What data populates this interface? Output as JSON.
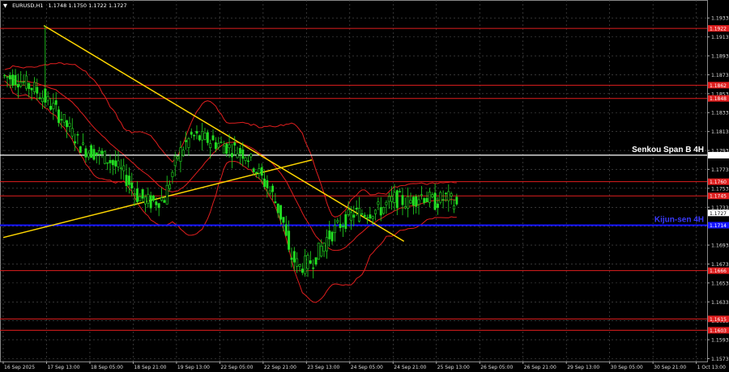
{
  "header": {
    "symbol": "EURUSD,H1",
    "ohlc": "1.1748 1.1750 1.1722 1.1727"
  },
  "chart_data": {
    "type": "candlestick",
    "symbol": "EURUSD,H1",
    "price_axis": {
      "min": 1.157,
      "max": 1.1952,
      "tick_labels": [
        "1.1933",
        "1.1913",
        "1.1893",
        "1.1873",
        "1.1853",
        "1.1833",
        "1.1813",
        "1.1793",
        "1.1773",
        "1.1753",
        "1.1733",
        "1.1713",
        "1.1693",
        "1.1673",
        "1.1653",
        "1.1633",
        "1.1613",
        "1.1593",
        "1.1573"
      ],
      "tick_values": [
        1.1933,
        1.1913,
        1.1893,
        1.1873,
        1.1853,
        1.1833,
        1.1813,
        1.1793,
        1.1773,
        1.1753,
        1.1733,
        1.1713,
        1.1693,
        1.1673,
        1.1653,
        1.1633,
        1.1613,
        1.1593,
        1.1573
      ]
    },
    "time_axis": {
      "labels": [
        "16 Sep 2025",
        "17 Sep 13:00",
        "18 Sep 05:00",
        "18 Sep 21:00",
        "19 Sep 13:00",
        "22 Sep 05:00",
        "22 Sep 21:00",
        "23 Sep 13:00",
        "24 Sep 05:00",
        "24 Sep 21:00",
        "25 Sep 13:00",
        "26 Sep 05:00",
        "26 Sep 21:00",
        "29 Sep 13:00",
        "30 Sep 05:00",
        "30 Sep 21:00",
        "1 Oct 13:00"
      ],
      "bars_per_label": 16,
      "total_bars": 260
    },
    "levels": [
      {
        "label": "1.1922",
        "value": 1.1922,
        "color": "#e01e1e"
      },
      {
        "label": "1.1862",
        "value": 1.1862,
        "color": "#e01e1e"
      },
      {
        "label": "1.1848",
        "value": 1.1848,
        "color": "#e01e1e"
      },
      {
        "label": "1.1788",
        "value": 1.1788,
        "color": "#ffffff",
        "name": "Senkou Span B 4H"
      },
      {
        "label": "1.1760",
        "value": 1.176,
        "color": "#e01e1e"
      },
      {
        "label": "1.1745",
        "value": 1.1745,
        "color": "#e01e1e"
      },
      {
        "label": "1.1727",
        "value": 1.1727,
        "color": "#ffffff",
        "current": true
      },
      {
        "label": "1.1714",
        "value": 1.1714,
        "color": "#1414ff",
        "name": "Kijun-sen 4H"
      },
      {
        "label": "1.1666",
        "value": 1.1666,
        "color": "#e01e1e"
      },
      {
        "label": "1.1615",
        "value": 1.1615,
        "color": "#e01e1e"
      },
      {
        "label": "1.1603",
        "value": 1.1603,
        "color": "#e01e1e"
      }
    ],
    "trendlines": [
      {
        "color": "#ffd700",
        "from": {
          "bar": 15,
          "price": 1.1925
        },
        "to": {
          "bar": 148,
          "price": 1.1697
        }
      },
      {
        "color": "#ffd700",
        "from": {
          "bar": 0,
          "price": 1.1701
        },
        "to": {
          "bar": 114,
          "price": 1.1783
        }
      }
    ],
    "price_path": [
      [
        0,
        1.1872
      ],
      [
        6,
        1.1868
      ],
      [
        12,
        1.1858
      ],
      [
        15,
        1.185
      ],
      [
        20,
        1.1835
      ],
      [
        25,
        1.1815
      ],
      [
        30,
        1.1795
      ],
      [
        35,
        1.179
      ],
      [
        40,
        1.1782
      ],
      [
        45,
        1.1768
      ],
      [
        50,
        1.1745
      ],
      [
        55,
        1.1738
      ],
      [
        60,
        1.1743
      ],
      [
        65,
        1.1788
      ],
      [
        70,
        1.1808
      ],
      [
        75,
        1.1805
      ],
      [
        80,
        1.18
      ],
      [
        85,
        1.1795
      ],
      [
        90,
        1.179
      ],
      [
        95,
        1.1768
      ],
      [
        100,
        1.1746
      ],
      [
        104,
        1.1716
      ],
      [
        106,
        1.1683
      ],
      [
        110,
        1.167
      ],
      [
        115,
        1.1677
      ],
      [
        120,
        1.17
      ],
      [
        125,
        1.1715
      ],
      [
        130,
        1.1726
      ],
      [
        135,
        1.1728
      ],
      [
        140,
        1.1731
      ],
      [
        145,
        1.1742
      ],
      [
        150,
        1.1738
      ],
      [
        155,
        1.1746
      ],
      [
        160,
        1.1738
      ],
      [
        164,
        1.1744
      ],
      [
        168,
        1.1735
      ]
    ],
    "bars_drawn": 168,
    "up_color": "#22dd22",
    "down_color": "#22dd22",
    "bollinger_color": "#e01e1e",
    "current_price": 1.1727,
    "labels": {
      "senkou": "Senkou Span B 4H",
      "kijun": "Kijun-sen 4H"
    }
  }
}
